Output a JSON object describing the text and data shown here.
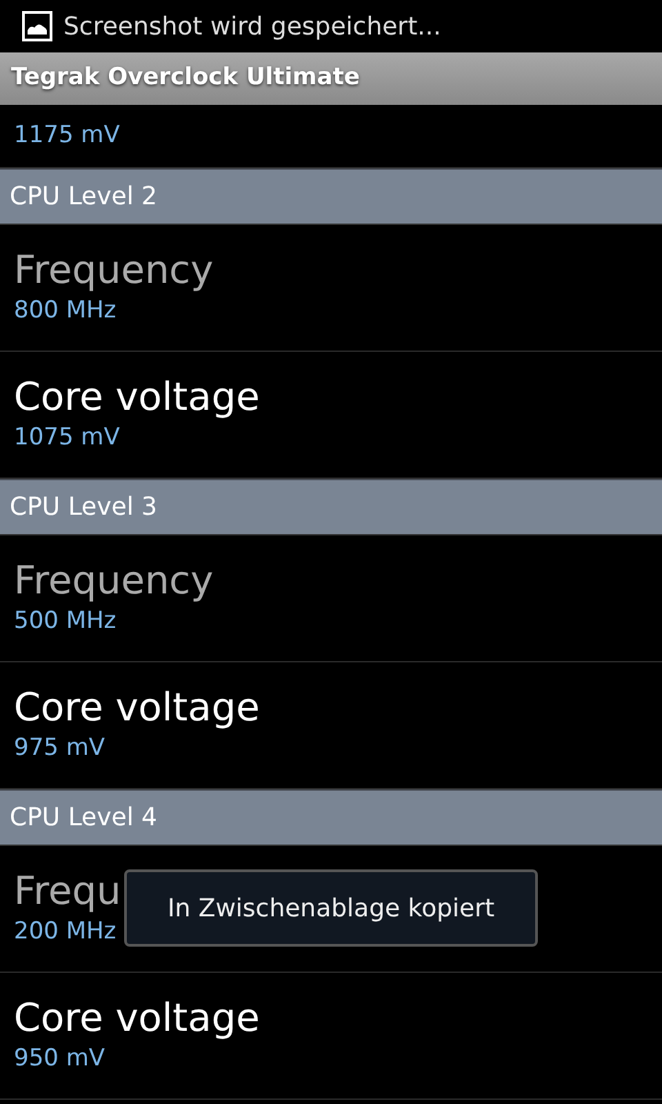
{
  "status_bar": {
    "notification": "Screenshot wird gespeichert..."
  },
  "title_bar": {
    "title": "Tegrak Overclock Ultimate"
  },
  "sections": [
    {
      "items": [
        {
          "summary": "1175 mV",
          "enabled": true
        }
      ]
    },
    {
      "header": "CPU Level 2",
      "items": [
        {
          "title": "Frequency",
          "summary": "800 MHz",
          "enabled": false
        },
        {
          "title": "Core voltage",
          "summary": "1075 mV",
          "enabled": true
        }
      ]
    },
    {
      "header": "CPU Level 3",
      "items": [
        {
          "title": "Frequency",
          "summary": "500 MHz",
          "enabled": false
        },
        {
          "title": "Core voltage",
          "summary": "975 mV",
          "enabled": true
        }
      ]
    },
    {
      "header": "CPU Level 4",
      "items": [
        {
          "title": "Frequ",
          "summary": "200 MHz",
          "enabled": false
        },
        {
          "title": "Core voltage",
          "summary": "950 mV",
          "enabled": true
        }
      ]
    }
  ],
  "toast": {
    "text": "In Zwischenablage kopiert"
  }
}
